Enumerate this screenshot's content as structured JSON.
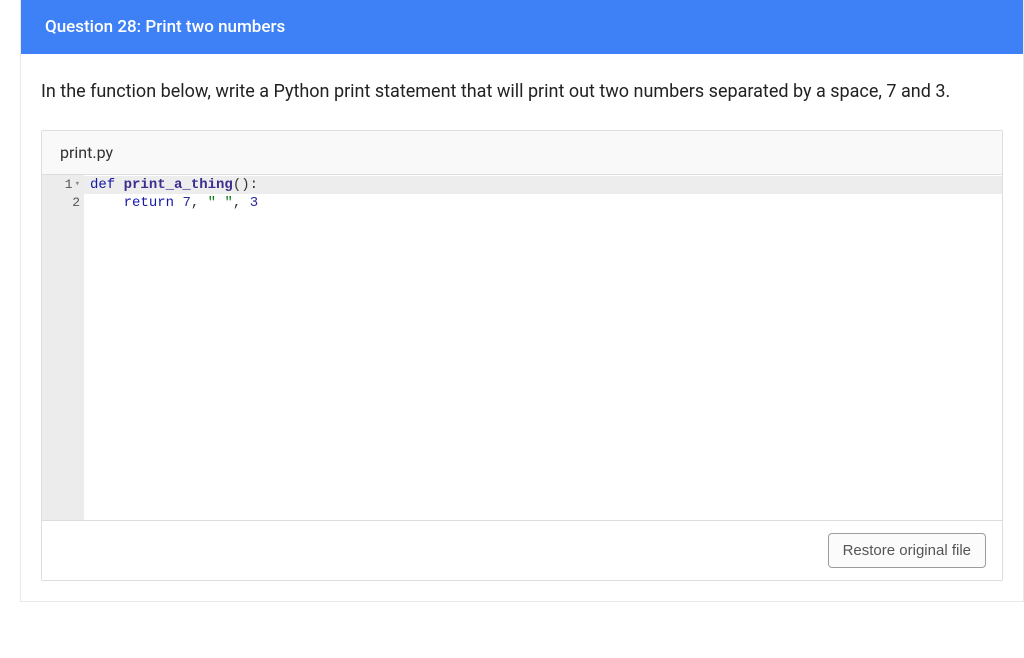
{
  "header": {
    "title": "Question 28: Print two numbers"
  },
  "prompt": {
    "text": "In the function below, write a Python print statement that will print out two numbers separated by a space, 7 and 3."
  },
  "editor": {
    "filename": "print.py",
    "lines": {
      "l1": {
        "num": "1",
        "kw_def": "def ",
        "fn_name": "print_a_thing",
        "parens_colon": "():"
      },
      "l2": {
        "num": "2",
        "indent": "    ",
        "kw_return": "return",
        "sp1": " ",
        "num1": "7",
        "comma1": ", ",
        "str": "\" \"",
        "comma2": ", ",
        "num2": "3"
      }
    }
  },
  "footer": {
    "restore_label": "Restore original file"
  }
}
